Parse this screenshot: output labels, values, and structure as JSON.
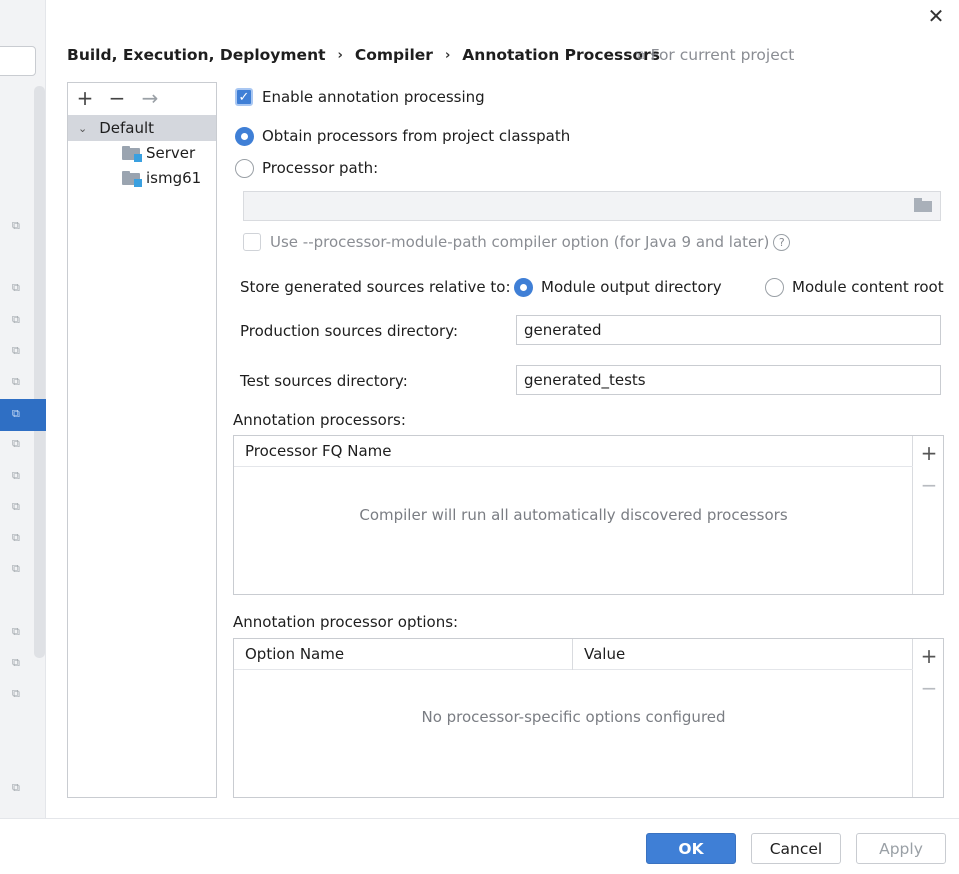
{
  "window": {
    "close_glyph": "✕"
  },
  "breadcrumb": {
    "items": [
      "Build, Execution, Deployment",
      "Compiler",
      "Annotation Processors"
    ],
    "separator": "›"
  },
  "scope": {
    "label": "For current project",
    "icon": "copy-icon"
  },
  "tree": {
    "toolbar": {
      "add": "+",
      "remove": "−",
      "move": "→"
    },
    "root": {
      "label": "Default",
      "expanded": true
    },
    "modules": [
      "Server",
      "ismg61"
    ]
  },
  "options": {
    "enable_processing": {
      "label": "Enable annotation processing",
      "checked": true
    },
    "obtain_from_classpath": {
      "label": "Obtain processors from project classpath",
      "selected": true
    },
    "processor_path": {
      "label": "Processor path:",
      "selected": false,
      "value": ""
    },
    "module_path_option": {
      "label": "Use --processor-module-path compiler option (for Java 9 and later)",
      "checked": false,
      "enabled": false,
      "help_glyph": "?"
    },
    "store_relative": {
      "label": "Store generated sources relative to:",
      "choices": [
        {
          "label": "Module output directory",
          "selected": true
        },
        {
          "label": "Module content root",
          "selected": false
        }
      ]
    },
    "production_dir": {
      "label": "Production sources directory:",
      "value": "generated"
    },
    "test_dir": {
      "label": "Test sources directory:",
      "value": "generated_tests"
    }
  },
  "processors_table": {
    "title": "Annotation processors:",
    "columns": [
      "Processor FQ Name"
    ],
    "empty_text": "Compiler will run all automatically discovered processors",
    "add": "+",
    "remove": "−"
  },
  "options_table": {
    "title": "Annotation processor options:",
    "columns": [
      "Option Name",
      "Value"
    ],
    "empty_text": "No processor-specific options configured",
    "add": "+",
    "remove": "−"
  },
  "footer": {
    "ok": "OK",
    "cancel": "Cancel",
    "apply": "Apply"
  },
  "colors": {
    "accent": "#3f7fd6",
    "selection": "#2f6fc4"
  }
}
